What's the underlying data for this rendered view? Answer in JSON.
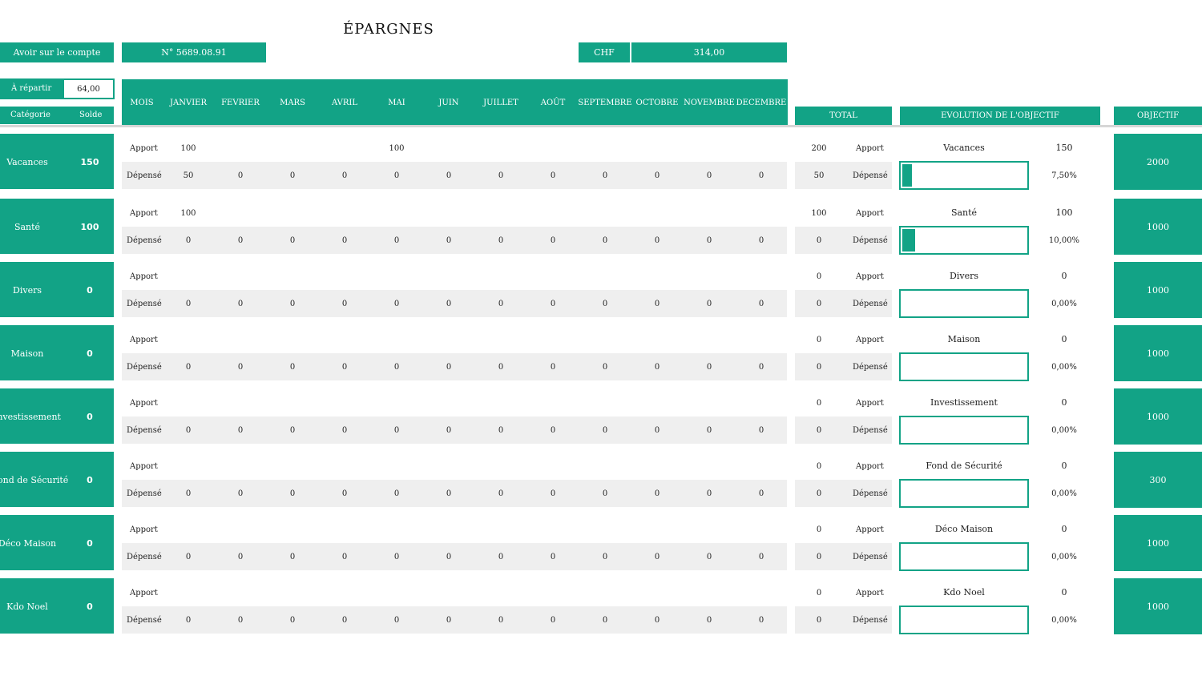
{
  "title": "ÉPARGNES",
  "account": {
    "label": "Avoir sur le compte",
    "number": "N° 5689.08.91",
    "currency": "CHF",
    "balance": "314,00"
  },
  "repartir": {
    "label": "À répartir",
    "value": "64,00"
  },
  "columns": {
    "category": "Catégorie",
    "balance": "Solde",
    "total": "TOTAL",
    "evolution": "EVOLUTION DE L'OBJECTIF",
    "objective": "OBJECTIF"
  },
  "months": [
    "MOIS",
    "JANVIER",
    "FEVRIER",
    "MARS",
    "AVRIL",
    "MAI",
    "JUIN",
    "JUILLET",
    "AOÛT",
    "SEPTEMBRE",
    "OCTOBRE",
    "NOVEMBRE",
    "DECEMBRE"
  ],
  "row_labels": {
    "apport": "Apport",
    "depense": "Dépensé"
  },
  "accent_color": "#12a386",
  "categories": [
    {
      "name": "Vacances",
      "solde": "150",
      "apport": [
        "100",
        "",
        "",
        "",
        "100",
        "",
        "",
        "",
        "",
        "",
        "",
        ""
      ],
      "depense": [
        "50",
        "0",
        "0",
        "0",
        "0",
        "0",
        "0",
        "0",
        "0",
        "0",
        "0",
        "0"
      ],
      "total_apport": "200",
      "total_depense": "50",
      "evo_name": "Vacances",
      "evo_value": "150",
      "percent": "7,50%",
      "progress": 0.075,
      "objective": "2000"
    },
    {
      "name": "Santé",
      "solde": "100",
      "apport": [
        "100",
        "",
        "",
        "",
        "",
        "",
        "",
        "",
        "",
        "",
        "",
        ""
      ],
      "depense": [
        "0",
        "0",
        "0",
        "0",
        "0",
        "0",
        "0",
        "0",
        "0",
        "0",
        "0",
        "0"
      ],
      "total_apport": "100",
      "total_depense": "0",
      "evo_name": "Santé",
      "evo_value": "100",
      "percent": "10,00%",
      "progress": 0.1,
      "objective": "1000"
    },
    {
      "name": "Divers",
      "solde": "0",
      "apport": [
        "",
        "",
        "",
        "",
        "",
        "",
        "",
        "",
        "",
        "",
        "",
        ""
      ],
      "depense": [
        "0",
        "0",
        "0",
        "0",
        "0",
        "0",
        "0",
        "0",
        "0",
        "0",
        "0",
        "0"
      ],
      "total_apport": "0",
      "total_depense": "0",
      "evo_name": "Divers",
      "evo_value": "0",
      "percent": "0,00%",
      "progress": 0,
      "objective": "1000"
    },
    {
      "name": "Maison",
      "solde": "0",
      "apport": [
        "",
        "",
        "",
        "",
        "",
        "",
        "",
        "",
        "",
        "",
        "",
        ""
      ],
      "depense": [
        "0",
        "0",
        "0",
        "0",
        "0",
        "0",
        "0",
        "0",
        "0",
        "0",
        "0",
        "0"
      ],
      "total_apport": "0",
      "total_depense": "0",
      "evo_name": "Maison",
      "evo_value": "0",
      "percent": "0,00%",
      "progress": 0,
      "objective": "1000"
    },
    {
      "name": "Investissement",
      "solde": "0",
      "apport": [
        "",
        "",
        "",
        "",
        "",
        "",
        "",
        "",
        "",
        "",
        "",
        ""
      ],
      "depense": [
        "0",
        "0",
        "0",
        "0",
        "0",
        "0",
        "0",
        "0",
        "0",
        "0",
        "0",
        "0"
      ],
      "total_apport": "0",
      "total_depense": "0",
      "evo_name": "Investissement",
      "evo_value": "0",
      "percent": "0,00%",
      "progress": 0,
      "objective": "1000"
    },
    {
      "name": "Fond de Sécurité",
      "solde": "0",
      "apport": [
        "",
        "",
        "",
        "",
        "",
        "",
        "",
        "",
        "",
        "",
        "",
        ""
      ],
      "depense": [
        "0",
        "0",
        "0",
        "0",
        "0",
        "0",
        "0",
        "0",
        "0",
        "0",
        "0",
        "0"
      ],
      "total_apport": "0",
      "total_depense": "0",
      "evo_name": "Fond de Sécurité",
      "evo_value": "0",
      "percent": "0,00%",
      "progress": 0,
      "objective": "300"
    },
    {
      "name": "Déco Maison",
      "solde": "0",
      "apport": [
        "",
        "",
        "",
        "",
        "",
        "",
        "",
        "",
        "",
        "",
        "",
        ""
      ],
      "depense": [
        "0",
        "0",
        "0",
        "0",
        "0",
        "0",
        "0",
        "0",
        "0",
        "0",
        "0",
        "0"
      ],
      "total_apport": "0",
      "total_depense": "0",
      "evo_name": "Déco Maison",
      "evo_value": "0",
      "percent": "0,00%",
      "progress": 0,
      "objective": "1000"
    },
    {
      "name": "Kdo Noel",
      "solde": "0",
      "apport": [
        "",
        "",
        "",
        "",
        "",
        "",
        "",
        "",
        "",
        "",
        "",
        ""
      ],
      "depense": [
        "0",
        "0",
        "0",
        "0",
        "0",
        "0",
        "0",
        "0",
        "0",
        "0",
        "0",
        "0"
      ],
      "total_apport": "0",
      "total_depense": "0",
      "evo_name": "Kdo Noel",
      "evo_value": "0",
      "percent": "0,00%",
      "progress": 0,
      "objective": "1000"
    }
  ]
}
